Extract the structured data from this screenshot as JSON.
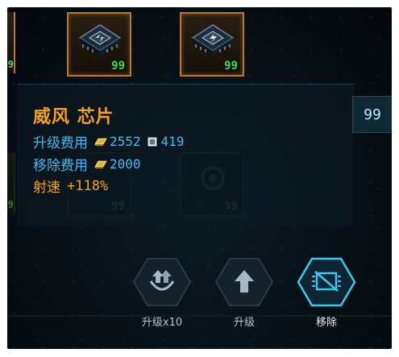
{
  "inventory": {
    "slots": [
      {
        "count": "99",
        "state": "active"
      },
      {
        "count": "99",
        "state": "active"
      },
      {
        "count": "99",
        "state": "dim"
      },
      {
        "count": "99",
        "state": "dim"
      }
    ],
    "edge_counts": [
      "9",
      "9"
    ]
  },
  "tooltip": {
    "title": "威风 芯片",
    "upgrade_cost_label": "升级费用",
    "upgrade_cost_gold": "2552",
    "upgrade_cost_chip": "419",
    "remove_cost_label": "移除费用",
    "remove_cost_gold": "2000",
    "stat_label": "射速",
    "stat_value": "+118%",
    "quantity": "99"
  },
  "actions": {
    "upgrade_x10": "升级x10",
    "upgrade": "升级",
    "remove": "移除"
  },
  "colors": {
    "accent_orange": "#f4a21e",
    "accent_blue": "#4ab8f0",
    "count_green": "#37e04a",
    "button_active": "#3bc8f0"
  },
  "icons": {
    "chip": "chip-icon",
    "gold": "gold-bar-icon",
    "chip_currency": "chip-currency-icon",
    "upgrade_x10": "double-arrow-up-icon",
    "upgrade": "arrow-up-icon",
    "remove": "remove-chip-icon"
  }
}
